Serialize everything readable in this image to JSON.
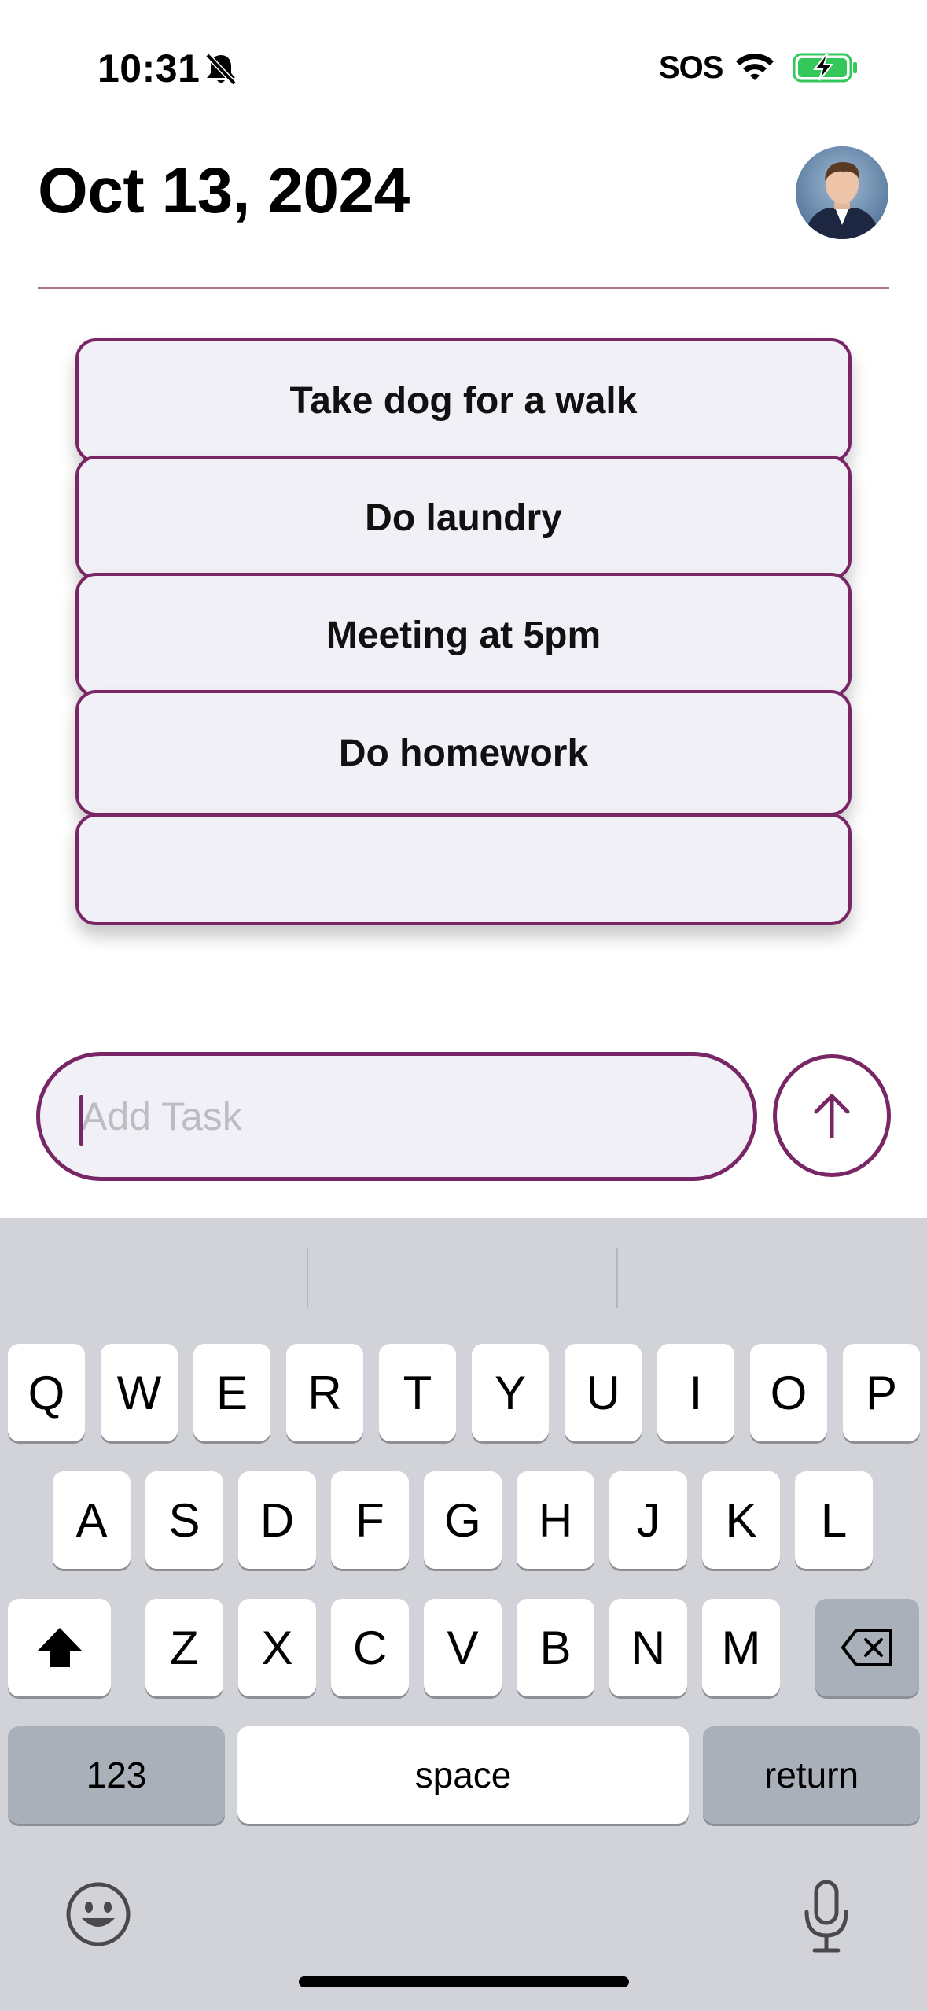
{
  "status_bar": {
    "time": "10:31",
    "sos": "SOS",
    "icons": [
      "bell-slash-icon",
      "wifi-icon",
      "battery-charging-icon"
    ]
  },
  "header": {
    "date": "Oct 13, 2024",
    "avatar": "profile-photo"
  },
  "tasks": [
    {
      "label": "Take dog for a walk"
    },
    {
      "label": "Do laundry"
    },
    {
      "label": "Meeting at 5pm"
    },
    {
      "label": "Do homework"
    },
    {
      "label": ""
    }
  ],
  "input": {
    "placeholder": "Add Task",
    "value": ""
  },
  "send_button": {
    "icon": "arrow-up-icon"
  },
  "keyboard": {
    "row1": [
      "Q",
      "W",
      "E",
      "R",
      "T",
      "Y",
      "U",
      "I",
      "O",
      "P"
    ],
    "row2": [
      "A",
      "S",
      "D",
      "F",
      "G",
      "H",
      "J",
      "K",
      "L"
    ],
    "row3": [
      "Z",
      "X",
      "C",
      "V",
      "B",
      "N",
      "M"
    ],
    "numbers_label": "123",
    "space_label": "space",
    "return_label": "return"
  },
  "colors": {
    "accent": "#782665",
    "card_background": "#f1f0f6",
    "keyboard_background": "#d1d3d9",
    "battery_green": "#34c759"
  }
}
